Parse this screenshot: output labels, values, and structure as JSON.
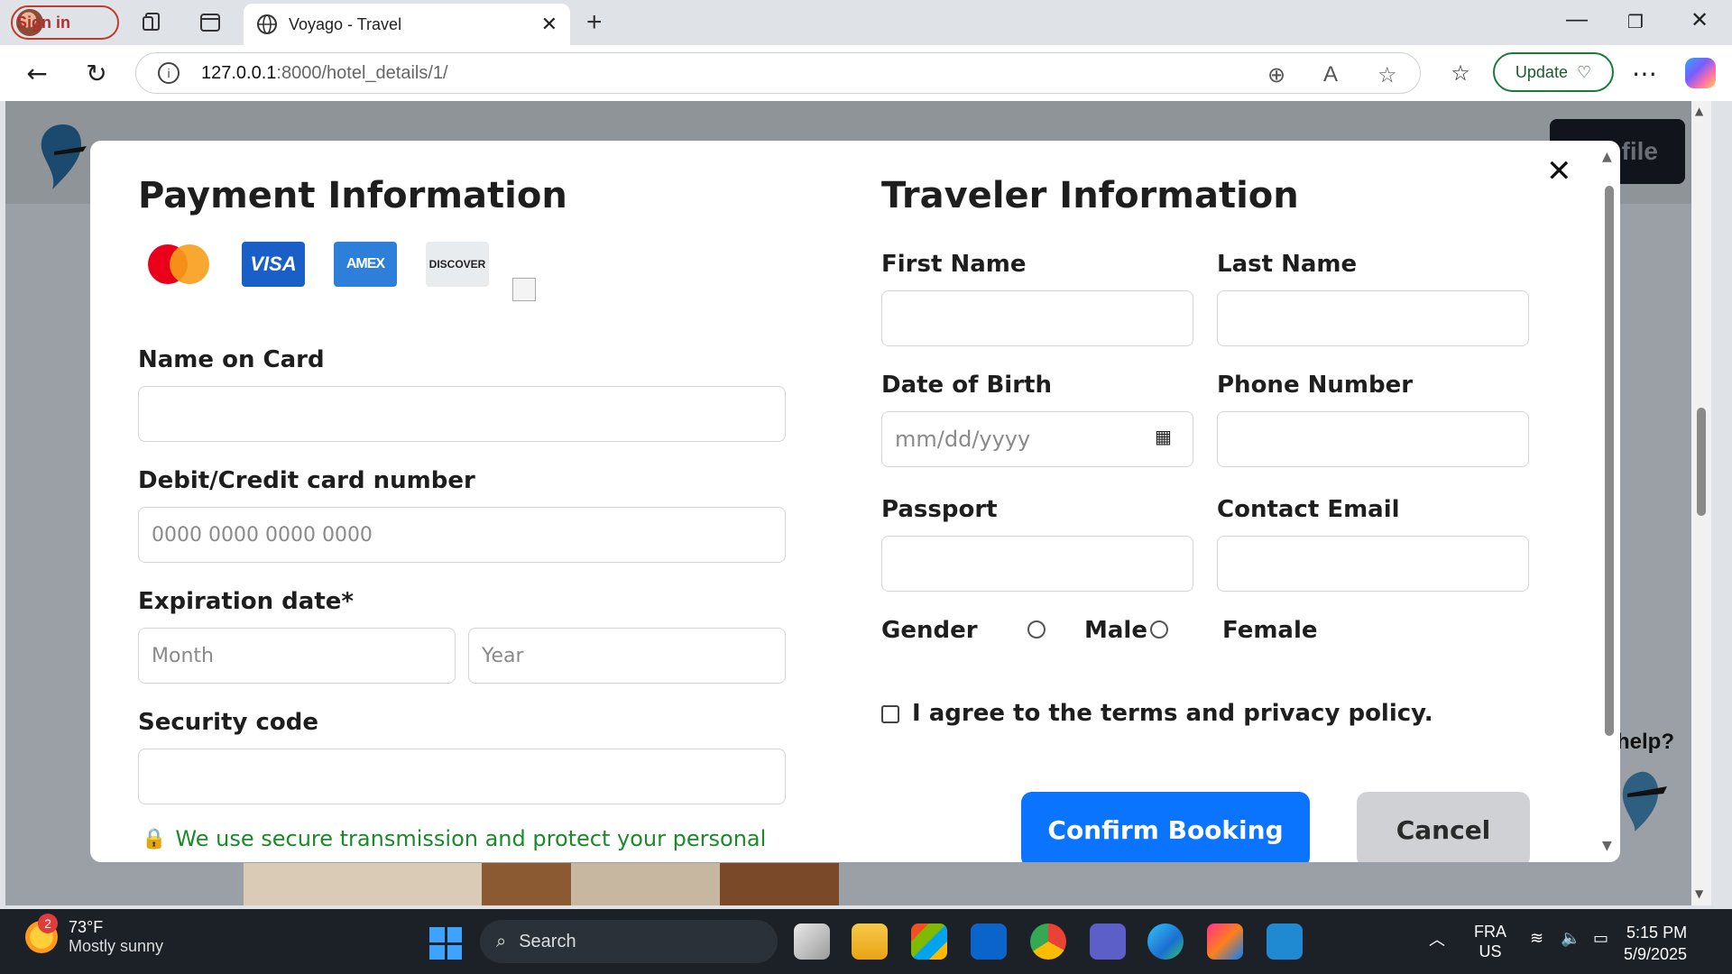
{
  "browser": {
    "sign_in": "Sign in",
    "tab_title": "Voyago - Travel",
    "url_host": "127.0.0.1",
    "url_rest": ":8000/hotel_details/1/",
    "update_label": "Update"
  },
  "page": {
    "profile_btn": "file",
    "help_text": "help?"
  },
  "payment": {
    "title": "Payment Information",
    "cards": [
      "mastercard",
      "VISA",
      "AMEX",
      "DISCOVER"
    ],
    "name_label": "Name on Card",
    "name_value": "",
    "card_label": "Debit/Credit card number",
    "card_placeholder": "0000 0000 0000 0000",
    "expiry_label": "Expiration date*",
    "month_placeholder": "Month",
    "year_placeholder": "Year",
    "security_label": "Security code",
    "security_value": "",
    "secure_note": "We use secure transmission and protect your personal"
  },
  "traveler": {
    "title": "Traveler Information",
    "first_name_label": "First Name",
    "last_name_label": "Last Name",
    "dob_label": "Date of Birth",
    "dob_placeholder": "mm/dd/yyyy",
    "phone_label": "Phone Number",
    "passport_label": "Passport",
    "email_label": "Contact Email",
    "gender_label": "Gender",
    "male_label": "Male",
    "female_label": "Female",
    "terms_label": "I agree to the terms and privacy policy."
  },
  "actions": {
    "confirm": "Confirm Booking",
    "cancel": "Cancel"
  },
  "taskbar": {
    "temp": "73°F",
    "weather": "Mostly sunny",
    "weather_badge": "2",
    "search": "Search",
    "lang1": "FRA",
    "lang2": "US",
    "time": "5:15 PM",
    "date": "5/9/2025"
  }
}
